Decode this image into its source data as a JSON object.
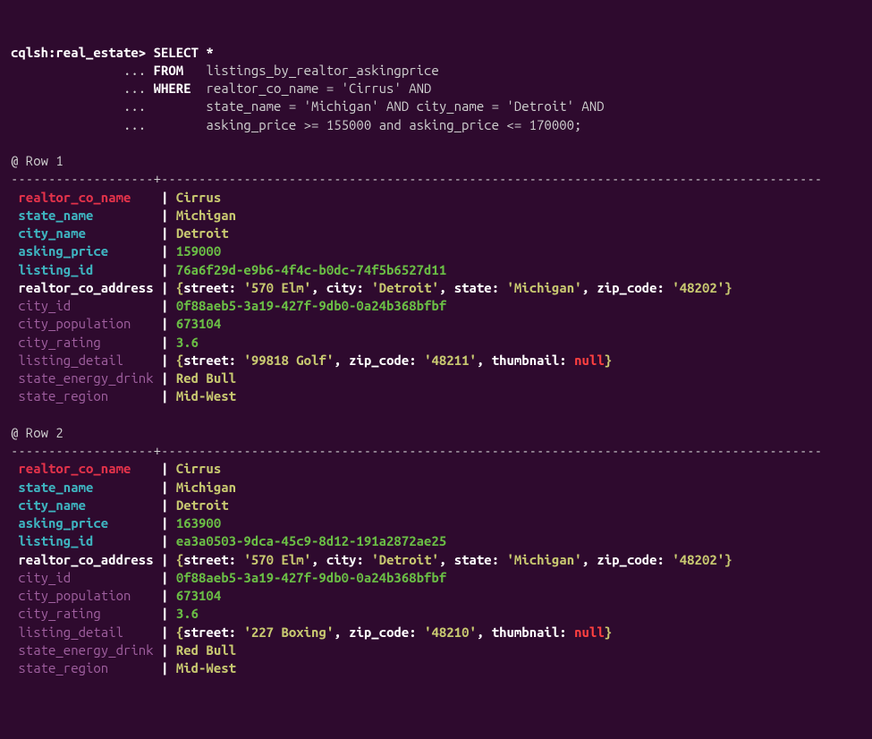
{
  "prompt": {
    "db": "cqlsh:real_estate> ",
    "continuation": "               ... ",
    "select": "SELECT",
    "star": "*",
    "from": "FROM",
    "table": "listings_by_realtor_askingprice",
    "where": "WHERE",
    "cond1": "realtor_co_name = 'Cirrus' AND",
    "cond2": "state_name = 'Michigan' AND city_name = 'Detroit' AND",
    "cond3": "asking_price >= 155000 and asking_price <= 170000;"
  },
  "row1": {
    "header": "@ Row 1",
    "realtor_co_name": "Cirrus",
    "state_name": "Michigan",
    "city_name": "Detroit",
    "asking_price": "159000",
    "listing_id": "76a6f29d-e9b6-4f4c-b0dc-74f5b6527d11",
    "realtor_co_address": {
      "open": "{",
      "street_k": "street:",
      "street_v": "'570 Elm'",
      "city_k": "city:",
      "city_v": "'Detroit'",
      "state_k": "state:",
      "state_v": "'Michigan'",
      "zip_k": "zip_code:",
      "zip_v": "'48202'",
      "close": "}"
    },
    "city_id": "0f88aeb5-3a19-427f-9db0-0a24b368bfbf",
    "city_population": "673104",
    "city_rating": "3.6",
    "listing_detail": {
      "open": "{",
      "street_k": "street:",
      "street_v": "'99818 Golf'",
      "zip_k": "zip_code:",
      "zip_v": "'48211'",
      "thumb_k": "thumbnail:",
      "thumb_v": "null",
      "close": "}"
    },
    "state_energy_drink": "Red Bull",
    "state_region": "Mid-West"
  },
  "row2": {
    "header": "@ Row 2",
    "realtor_co_name": "Cirrus",
    "state_name": "Michigan",
    "city_name": "Detroit",
    "asking_price": "163900",
    "listing_id": "ea3a0503-9dca-45c9-8d12-191a2872ae25",
    "realtor_co_address": {
      "open": "{",
      "street_k": "street:",
      "street_v": "'570 Elm'",
      "city_k": "city:",
      "city_v": "'Detroit'",
      "state_k": "state:",
      "state_v": "'Michigan'",
      "zip_k": "zip_code:",
      "zip_v": "'48202'",
      "close": "}"
    },
    "city_id": "0f88aeb5-3a19-427f-9db0-0a24b368bfbf",
    "city_population": "673104",
    "city_rating": "3.6",
    "listing_detail": {
      "open": "{",
      "street_k": "street:",
      "street_v": "'227 Boxing'",
      "zip_k": "zip_code:",
      "zip_v": "'48210'",
      "thumb_k": "thumbnail:",
      "thumb_v": "null",
      "close": "}"
    },
    "state_energy_drink": "Red Bull",
    "state_region": "Mid-West"
  },
  "labels": {
    "realtor_co_name": "realtor_co_name   ",
    "state_name": "state_name        ",
    "city_name": "city_name         ",
    "asking_price": "asking_price      ",
    "listing_id": "listing_id        ",
    "realtor_co_address": "realtor_co_address",
    "city_id": "city_id           ",
    "city_population": "city_population   ",
    "city_rating": "city_rating       ",
    "listing_detail": "listing_detail    ",
    "state_energy_drink": "state_energy_drink",
    "state_region": "state_region      "
  },
  "sep": " | ",
  "dash": "-------------------+----------------------------------------------------------------------------------------",
  "gap": "                         "
}
